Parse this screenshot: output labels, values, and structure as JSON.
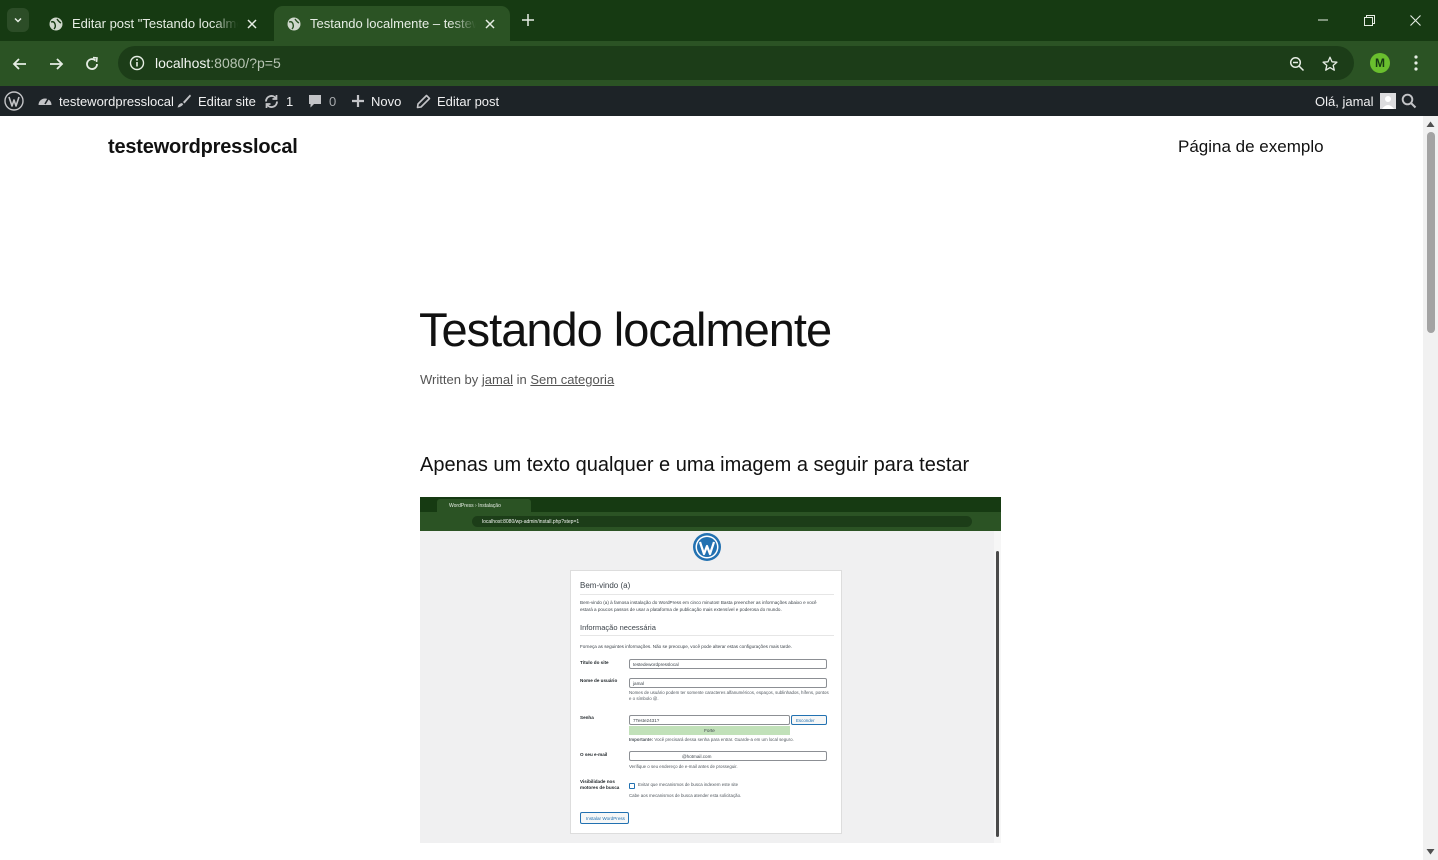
{
  "browser": {
    "tabs": [
      {
        "title": "Editar post \"Testando localmente\" ‹ testewordpresslocal",
        "active": false
      },
      {
        "title": "Testando localmente – testewordpresslocal",
        "active": true
      }
    ],
    "url_host": "localhost",
    "url_rest": ":8080/?p=5",
    "profile_initial": "M",
    "theme_colors": {
      "frame": "#163a12",
      "toolbar": "#2b5324"
    }
  },
  "admin_bar": {
    "site_name": "testewordpresslocal",
    "edit_site": "Editar site",
    "updates_count": "1",
    "comments_count": "0",
    "new_label": "Novo",
    "edit_post": "Editar post",
    "greeting": "Olá, jamal"
  },
  "site": {
    "title": "testewordpresslocal",
    "nav_item": "Página de exemplo"
  },
  "post": {
    "title": "Testando localmente",
    "meta_prefix": "Written by",
    "author": "jamal",
    "meta_in": "in",
    "category": "Sem categoria",
    "body_text": "Apenas um texto qualquer e uma imagem a seguir para testar"
  },
  "embedded_screenshot": {
    "tab_title": "WordPress › Instalação",
    "url": "localhost:8080/wp-admin/install.php?step=1",
    "welcome_heading": "Bem-vindo (a)",
    "welcome_text": "Bem-vindo (a) à famosa instalação do WordPress em cinco minutos! Basta preencher as informações abaixo e você estará a poucos passos de usar a plataforma de publicação mais extensível e poderosa do mundo.",
    "info_heading": "Informação necessária",
    "info_text": "Forneça as seguintes informações. Não se preocupe, você pode alterar estas configurações mais tarde.",
    "site_title_label": "Título do site",
    "site_title_value": "testedewordpresslocal",
    "username_label": "Nome de usuário",
    "username_value": "jamal",
    "username_help": "Nomes de usuário podem ter somente caracteres alfanuméricos, espaços, sublinhados, hífens, pontos e o símbolo @.",
    "password_label": "Senha",
    "password_value": "7Teste2431?",
    "hide_button": "Esconder",
    "strength": "Forte",
    "password_help_bold": "Importante:",
    "password_help": "Você precisará dessa senha para entrar. Guarde-a em um local seguro.",
    "email_label": "O seu e-mail",
    "email_value": "@hotmail.com",
    "email_help": "Verifique o seu endereço de e-mail antes de prosseguir.",
    "visibility_label": "Visibilidade nos motores de busca",
    "visibility_check": "Evitar que mecanismos de busca indexem este site",
    "visibility_help": "Cabe aos mecanismos de busca atender esta solicitação.",
    "install_button": "Instalar WordPress"
  }
}
